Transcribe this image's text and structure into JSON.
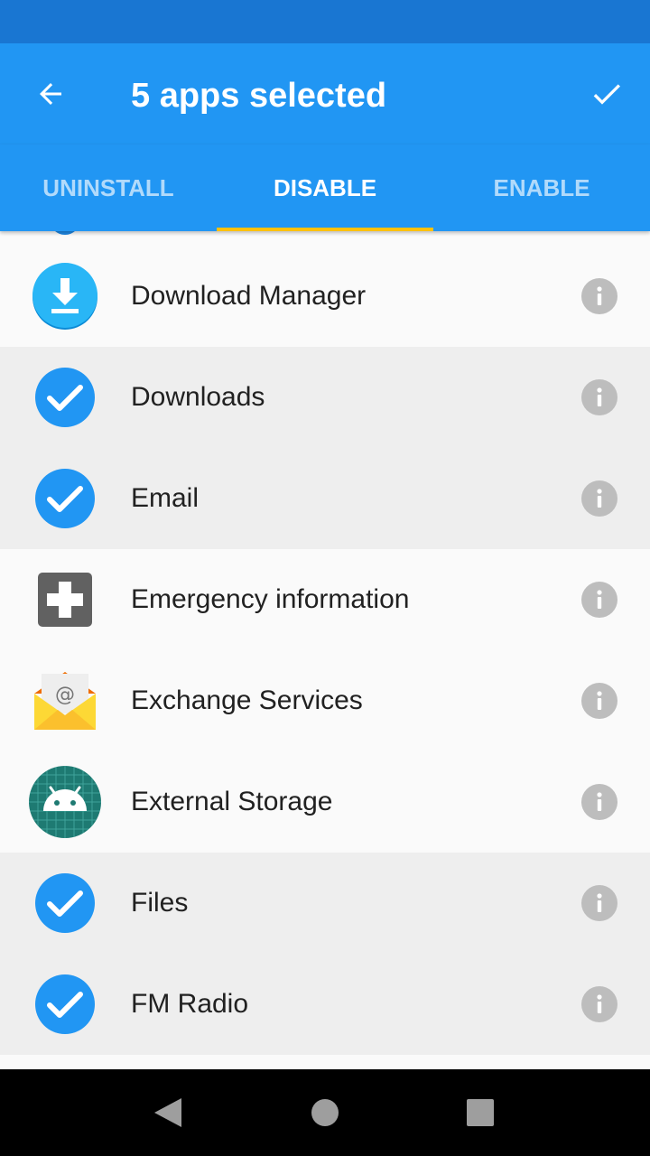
{
  "toolbar": {
    "title": "5 apps selected",
    "back_icon": "arrow-back-icon",
    "confirm_icon": "check-icon",
    "color": "#2196f3",
    "status_bar_color": "#1976d2"
  },
  "tabs": [
    {
      "label": "UNINSTALL",
      "active": false
    },
    {
      "label": "DISABLE",
      "active": true
    },
    {
      "label": "ENABLE",
      "active": false
    }
  ],
  "tab_indicator_color": "#ffc107",
  "apps": [
    {
      "name": "Download Manager",
      "selected": false,
      "icon": "download-manager-icon"
    },
    {
      "name": "Downloads",
      "selected": true,
      "icon": "checked-circle-icon"
    },
    {
      "name": "Email",
      "selected": true,
      "icon": "checked-circle-icon"
    },
    {
      "name": "Emergency information",
      "selected": false,
      "icon": "emergency-info-icon"
    },
    {
      "name": "Exchange Services",
      "selected": false,
      "icon": "exchange-envelope-icon"
    },
    {
      "name": "External Storage",
      "selected": false,
      "icon": "android-storage-icon"
    },
    {
      "name": "Files",
      "selected": true,
      "icon": "checked-circle-icon"
    },
    {
      "name": "FM Radio",
      "selected": true,
      "icon": "checked-circle-icon"
    }
  ],
  "nav": {
    "back_icon": "nav-back-icon",
    "home_icon": "nav-home-icon",
    "recents_icon": "nav-recents-icon"
  }
}
